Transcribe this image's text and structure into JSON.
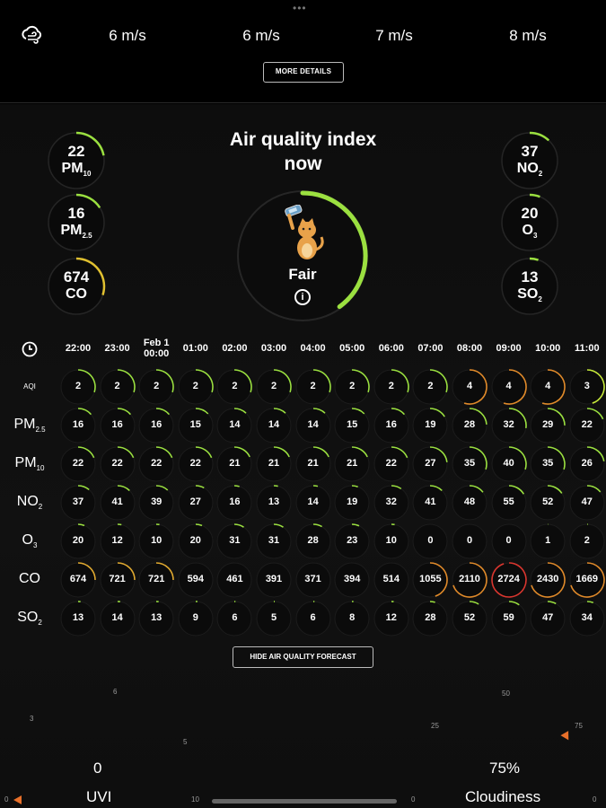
{
  "wind": {
    "values": [
      "6 m/s",
      "6 m/s",
      "7 m/s",
      "8 m/s"
    ],
    "more_label": "MORE DETAILS"
  },
  "aqi": {
    "title_line1": "Air quality index",
    "title_line2": "now",
    "status": "Fair",
    "info_glyph": "i",
    "gauge_fraction": 0.4,
    "colors": {
      "good": "#9be040",
      "fair": "#c6e83a",
      "moderate": "#e0a930",
      "poor": "#e08a2a",
      "bad": "#d9362f"
    },
    "left": [
      {
        "value": "22",
        "name": "PM",
        "sub": "10",
        "fraction": 0.22,
        "color": "#9be040"
      },
      {
        "value": "16",
        "name": "PM",
        "sub": "2.5",
        "fraction": 0.16,
        "color": "#9be040"
      },
      {
        "value": "674",
        "name": "CO",
        "sub": "",
        "fraction": 0.3,
        "color": "#e0c030"
      }
    ],
    "right": [
      {
        "value": "37",
        "name": "NO",
        "sub": "2",
        "fraction": 0.12,
        "color": "#9be040"
      },
      {
        "value": "20",
        "name": "O",
        "sub": "3",
        "fraction": 0.06,
        "color": "#9be040"
      },
      {
        "value": "13",
        "name": "SO",
        "sub": "2",
        "fraction": 0.05,
        "color": "#9be040"
      }
    ]
  },
  "forecast": {
    "hours": [
      {
        "l1": "22:00",
        "l2": ""
      },
      {
        "l1": "23:00",
        "l2": ""
      },
      {
        "l1": "Feb 1",
        "l2": "00:00"
      },
      {
        "l1": "01:00",
        "l2": ""
      },
      {
        "l1": "02:00",
        "l2": ""
      },
      {
        "l1": "03:00",
        "l2": ""
      },
      {
        "l1": "04:00",
        "l2": ""
      },
      {
        "l1": "05:00",
        "l2": ""
      },
      {
        "l1": "06:00",
        "l2": ""
      },
      {
        "l1": "07:00",
        "l2": ""
      },
      {
        "l1": "08:00",
        "l2": ""
      },
      {
        "l1": "09:00",
        "l2": ""
      },
      {
        "l1": "10:00",
        "l2": ""
      },
      {
        "l1": "11:00",
        "l2": ""
      }
    ],
    "rows": [
      {
        "name": "AQI",
        "sub": "",
        "small": true,
        "values": [
          2,
          2,
          2,
          2,
          2,
          2,
          2,
          2,
          2,
          2,
          4,
          4,
          4,
          3
        ]
      },
      {
        "name": "PM",
        "sub": "2.5",
        "small": false,
        "values": [
          16,
          16,
          16,
          15,
          14,
          14,
          14,
          15,
          16,
          19,
          28,
          32,
          29,
          22
        ]
      },
      {
        "name": "PM",
        "sub": "10",
        "small": false,
        "values": [
          22,
          22,
          22,
          22,
          21,
          21,
          21,
          21,
          22,
          27,
          35,
          40,
          35,
          26
        ]
      },
      {
        "name": "NO",
        "sub": "2",
        "small": false,
        "values": [
          37,
          41,
          39,
          27,
          16,
          13,
          14,
          19,
          32,
          41,
          48,
          55,
          52,
          47
        ]
      },
      {
        "name": "O",
        "sub": "3",
        "small": false,
        "values": [
          20,
          12,
          10,
          20,
          31,
          31,
          28,
          23,
          10,
          0,
          0,
          0,
          1,
          2
        ]
      },
      {
        "name": "CO",
        "sub": "",
        "small": false,
        "values": [
          674,
          721,
          721,
          594,
          461,
          391,
          371,
          394,
          514,
          1055,
          2110,
          2724,
          2430,
          1669
        ]
      },
      {
        "name": "SO",
        "sub": "2",
        "small": false,
        "values": [
          13,
          14,
          13,
          9,
          6,
          5,
          6,
          8,
          12,
          28,
          52,
          59,
          47,
          34
        ]
      }
    ],
    "hide_label": "HIDE AIR QUALITY FORECAST"
  },
  "bottom": {
    "uvi_value": "0",
    "uvi_label": "UVI",
    "cloud_value": "75%",
    "cloud_label": "Cloudiness",
    "ticks": [
      "6",
      "3",
      "5",
      "10",
      "50",
      "25",
      "75",
      "0"
    ]
  }
}
